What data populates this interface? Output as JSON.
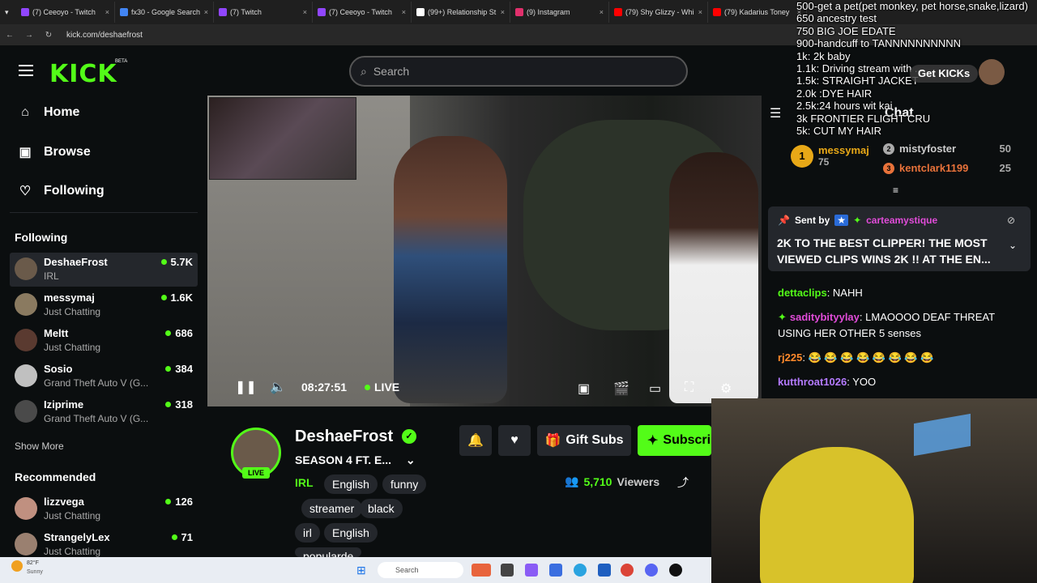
{
  "browser": {
    "tabs": [
      {
        "title": "(7) Ceeoyo - Twitch",
        "color": "#9146ff"
      },
      {
        "title": "fx30 - Google Search",
        "color": "#4285f4"
      },
      {
        "title": "(7) Twitch",
        "color": "#9146ff"
      },
      {
        "title": "(7) Ceeoyo - Twitch",
        "color": "#9146ff"
      },
      {
        "title": "(99+) Relationship St",
        "color": "#ffffff"
      },
      {
        "title": "(9) Instagram",
        "color": "#e1306c"
      },
      {
        "title": "(79) Shy Glizzy - Whi",
        "color": "#ff0000"
      },
      {
        "title": "(79) Kadarius Toney",
        "color": "#ff0000"
      }
    ],
    "url": "kick.com/deshaefrost"
  },
  "header": {
    "logo": "KICK",
    "beta": "BETA",
    "search_placeholder": "Search",
    "get_kicks": "Get KICKs"
  },
  "sidebar": {
    "nav": [
      {
        "label": "Home",
        "icon": "home-icon"
      },
      {
        "label": "Browse",
        "icon": "browse-icon"
      },
      {
        "label": "Following",
        "icon": "heart-icon"
      }
    ],
    "following_title": "Following",
    "following": [
      {
        "name": "DeshaeFrost",
        "category": "IRL",
        "viewers": "5.7K"
      },
      {
        "name": "messymaj",
        "category": "Just Chatting",
        "viewers": "1.6K"
      },
      {
        "name": "Meltt",
        "category": "Just Chatting",
        "viewers": "686"
      },
      {
        "name": "Sosio",
        "category": "Grand Theft Auto V (G...",
        "viewers": "384"
      },
      {
        "name": "Iziprime",
        "category": "Grand Theft Auto V (G...",
        "viewers": "318"
      }
    ],
    "show_more": "Show More",
    "recommended_title": "Recommended",
    "recommended": [
      {
        "name": "lizzvega",
        "category": "Just Chatting",
        "viewers": "126"
      },
      {
        "name": "StrangelyLex",
        "category": "Just Chatting",
        "viewers": "71"
      }
    ]
  },
  "player": {
    "time": "08:27:51",
    "live": "LIVE"
  },
  "channel": {
    "name": "DeshaeFrost",
    "title": "SEASON 4 FT. E...",
    "live_badge": "LIVE",
    "category": "IRL",
    "tags": [
      "English",
      "funny",
      "streamer",
      "black",
      "irl",
      "English",
      "popularde"
    ],
    "gift_subs": "Gift Subs",
    "subscribe": "Subscri",
    "viewers": "5,710",
    "viewers_label": "Viewers"
  },
  "chat": {
    "title": "Chat",
    "leaderboard": [
      {
        "name": "messymaj",
        "count": "75"
      },
      {
        "name": "mistyfoster",
        "count": "50"
      },
      {
        "name": "kentclark1199",
        "count": "25"
      }
    ],
    "pinned": {
      "sent_by": "Sent by",
      "user": "carteamystique",
      "text": "2K TO THE BEST CLIPPER! THE MOST VIEWED CLIPS WINS 2K !! AT THE EN..."
    },
    "messages": [
      {
        "user": "dettaclips",
        "text": "NAHH",
        "color": "#53fc18"
      },
      {
        "user": "saditybityylay",
        "text": "LMAOOOO DEAF THREAT USING HER OTHER 5 senses",
        "color": "#e14cd9"
      },
      {
        "user": "rj225",
        "text": "😂 😂 😂 😂 😂 😂 😂 😂",
        "color": "#ff8a2b"
      },
      {
        "user": "kutthroat1026",
        "text": "YOO",
        "color": "#b57bff"
      }
    ]
  },
  "overlay_goals": [
    "500-get a pet(pet monkey, pet horse,snake,lizard)",
    "650 ancestry test",
    "750 BIG JOE EDATE",
    "900-handcuff to TANNNNNNNNNN",
    "1k: 2k baby",
    "1.1k: Driving stream with ...",
    "1.5k: STRAIGHT JACKET",
    "2.0k :DYE HAIR",
    "2.5k:24 hours wit kai",
    "3k FRONTIER FLIGHT CRU",
    "5k: CUT MY HAIR"
  ],
  "taskbar": {
    "weather_temp": "82°F",
    "weather_desc": "Sunny",
    "search": "Search"
  }
}
